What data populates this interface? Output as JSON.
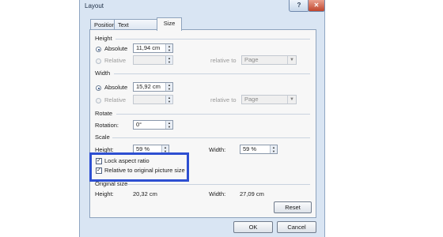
{
  "dialog": {
    "title": "Layout",
    "help_glyph": "?",
    "close_glyph": "✕"
  },
  "tabs": [
    {
      "label": "Position"
    },
    {
      "label": "Text Wrapping"
    },
    {
      "label": "Size"
    }
  ],
  "active_tab": "Size",
  "height": {
    "section": "Height",
    "absolute_label": "Absolute",
    "absolute_value": "11,94 cm",
    "relative_label": "Relative",
    "relative_to_label": "relative to",
    "relative_to_value": "Page",
    "mode": "absolute"
  },
  "width": {
    "section": "Width",
    "absolute_label": "Absolute",
    "absolute_value": "15,92 cm",
    "relative_label": "Relative",
    "relative_to_label": "relative to",
    "relative_to_value": "Page",
    "mode": "absolute"
  },
  "rotate": {
    "section": "Rotate",
    "rotation_label": "Rotation:",
    "rotation_value": "0°"
  },
  "scale": {
    "section": "Scale",
    "height_label": "Height:",
    "height_value": "59 %",
    "width_label": "Width:",
    "width_value": "59 %",
    "lock_aspect_label": "Lock aspect ratio",
    "lock_aspect_checked": true,
    "relative_original_label": "Relative to original picture size",
    "relative_original_checked": true
  },
  "original_size": {
    "section": "Original size",
    "height_label": "Height:",
    "height_value": "20,32 cm",
    "width_label": "Width:",
    "width_value": "27,09 cm"
  },
  "buttons": {
    "reset": "Reset",
    "ok": "OK",
    "cancel": "Cancel"
  },
  "colors": {
    "highlight_border": "#2d4fd1",
    "dialog_frame": "#d9e5f3"
  }
}
